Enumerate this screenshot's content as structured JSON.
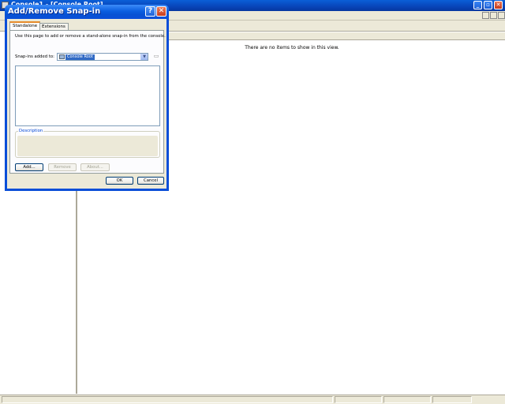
{
  "app": {
    "title": "Console1 - [Console Root]",
    "window_controls": {
      "minimize": "_",
      "restore": "▫",
      "close": "✕"
    },
    "result_pane": {
      "empty_message": "There are no items to show in this view."
    }
  },
  "dialog": {
    "title": "Add/Remove Snap-in",
    "help_glyph": "?",
    "close_glyph": "✕",
    "tabs": [
      {
        "label": "Standalone",
        "selected": true
      },
      {
        "label": "Extensions",
        "selected": false
      }
    ],
    "intro_text": "Use this page to add or remove a stand-alone snap-in from the console.",
    "snapins_label": "Snap-ins added to:",
    "snapins_combo": {
      "value": "Console Root",
      "arrow": "▼"
    },
    "folder_icon_glyph": "▭",
    "description_label": "Description",
    "buttons": {
      "add": "Add...",
      "remove": "Remove",
      "about": "About...",
      "ok": "OK",
      "cancel": "Cancel"
    }
  },
  "colors": {
    "titlebar": "#0a5ee0",
    "dialog_face": "#ece9d8",
    "selection": "#316ac5",
    "group_label": "#0046d5"
  }
}
